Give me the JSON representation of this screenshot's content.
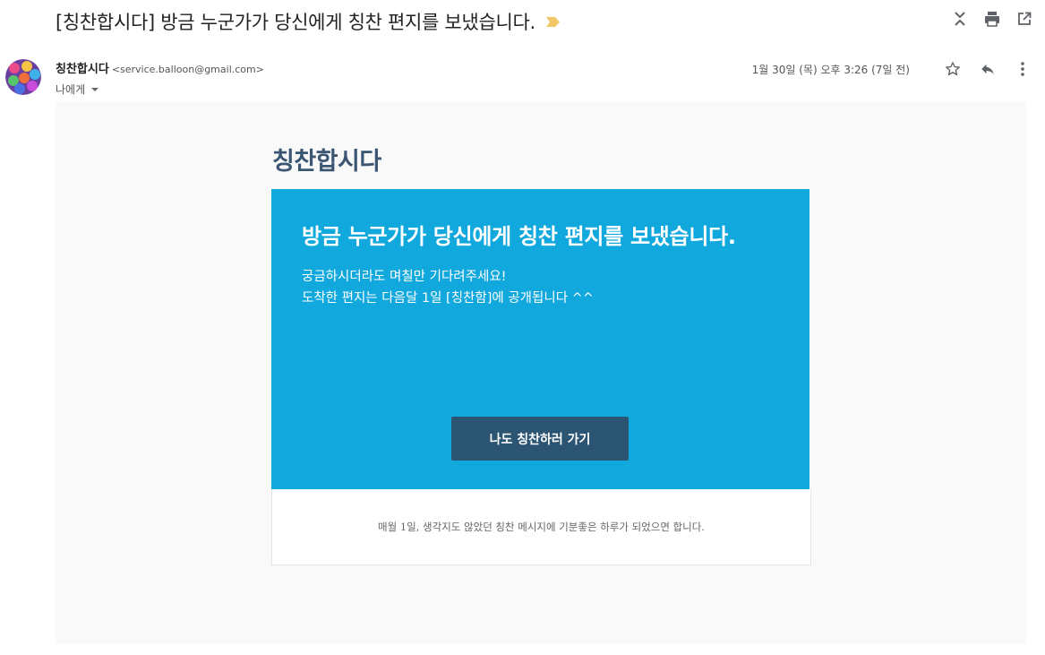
{
  "subject": "[칭찬합시다] 방금 누군가가 당신에게 칭찬 편지를 보냈습니다.",
  "colors": {
    "label_tag": "#f3c66a",
    "card_bg": "#11a8dd",
    "cta_bg": "#2c5574",
    "brand": "#3b5672"
  },
  "toolbar": {
    "icons": [
      "expand-collapse-icon",
      "print-icon",
      "open-new-window-icon"
    ]
  },
  "sender": {
    "name": "칭찬합시다",
    "email": "<service.balloon@gmail.com>",
    "to": "나에게",
    "date": "1월 30일 (목) 오후 3:26 (7일 전)"
  },
  "actions": {
    "icons": [
      "star-icon",
      "reply-icon",
      "more-vert-icon"
    ]
  },
  "body": {
    "brand": "칭찬합시다",
    "card_title": "방금 누군가가 당신에게 칭찬 편지를 보냈습니다.",
    "line1": "궁금하시더라도 며칠만 기다려주세요!",
    "line2": "도착한 편지는 다음달 1일 [칭찬함]에 공개됩니다 ^^",
    "cta_label": "나도 칭찬하러 가기",
    "footer": "매월 1일, 생각지도 않았던 칭찬 메시지에 기분좋은 하루가 되었으면 합니다."
  }
}
